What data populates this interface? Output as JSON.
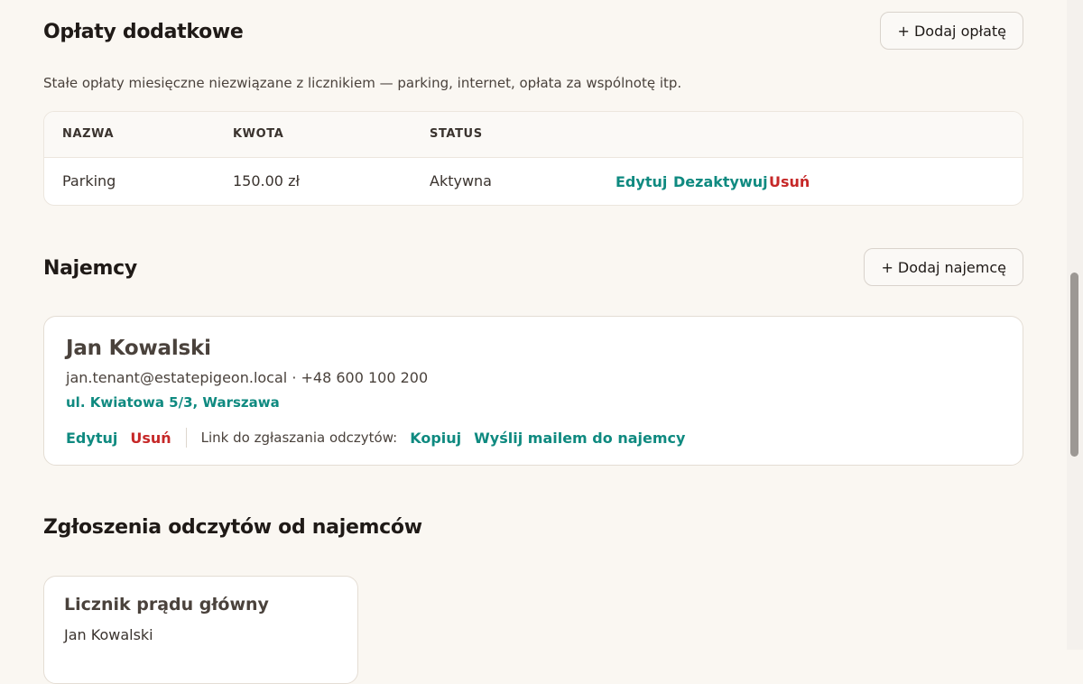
{
  "fees_section": {
    "title": "Opłaty dodatkowe",
    "add_button": "+ Dodaj opłatę",
    "description": "Stałe opłaty miesięczne niezwiązane z licznikiem — parking, internet, opłata za wspólnotę itp.",
    "columns": [
      "NAZWA",
      "KWOTA",
      "STATUS"
    ],
    "rows": [
      {
        "name": "Parking",
        "amount": "150.00 zł",
        "status": "Aktywna",
        "actions": {
          "edit": "Edytuj",
          "deactivate": "Dezaktywuj",
          "delete": "Usuń"
        }
      }
    ]
  },
  "tenants_section": {
    "title": "Najemcy",
    "add_button": "+ Dodaj najemcę",
    "tenants": [
      {
        "name": "Jan Kowalski",
        "contact": "jan.tenant@estatepigeon.local · +48 600 100 200",
        "address": "ul. Kwiatowa 5/3, Warszawa",
        "actions": {
          "edit": "Edytuj",
          "delete": "Usuń",
          "link_label": "Link do zgłaszania odczytów:",
          "copy": "Kopiuj",
          "send_mail": "Wyślij mailem do najemcy"
        }
      }
    ]
  },
  "readings_section": {
    "title": "Zgłoszenia odczytów od najemców",
    "cards": [
      {
        "meter": "Licznik prądu główny",
        "tenant": "Jan Kowalski"
      }
    ]
  },
  "colors": {
    "accent": "#0f8a80",
    "danger": "#c62828",
    "background": "#faf7f2"
  }
}
